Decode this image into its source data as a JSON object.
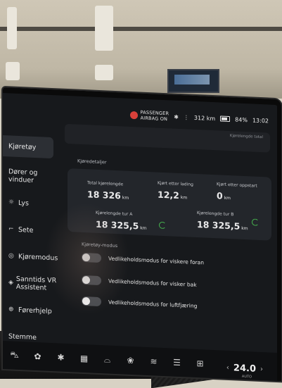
{
  "status_bar": {
    "airbag_line1": "PASSENGER",
    "airbag_line2": "AIRBAG ON",
    "range": "312 km",
    "battery": "84%",
    "time": "13:02"
  },
  "search": {
    "hint": "Kjørelengde total"
  },
  "sidebar": {
    "items": [
      {
        "label": "Kjøretøy",
        "icon": "car-icon"
      },
      {
        "label": "Dører og vinduer",
        "icon": "door-icon"
      },
      {
        "label": "Lys",
        "icon": "light-icon"
      },
      {
        "label": "Sete",
        "icon": "seat-icon"
      },
      {
        "label": "Kjøremodus",
        "icon": "steering-wheel-icon"
      },
      {
        "label": "Sanntids VR Assistent",
        "icon": "vr-assistant-icon"
      },
      {
        "label": "Førerhjelp",
        "icon": "driver-assist-icon"
      },
      {
        "label": "Stemme",
        "icon": "voice-icon"
      }
    ]
  },
  "details": {
    "title": "Kjøredetaljer",
    "total_label": "Total kjørelengde",
    "total_value": "18 326",
    "since_charge_label": "Kjørt etter lading",
    "since_charge_value": "12,2",
    "since_start_label": "Kjørt etter oppstart",
    "since_start_value": "0",
    "trip_a_label": "Kjørelengde tur A",
    "trip_a_value": "18 325,5",
    "trip_b_label": "Kjørelengde tur B",
    "trip_b_value": "18 325,5",
    "unit": "km"
  },
  "vehicle_mode": {
    "title": "Kjøretøy-modus",
    "toggles": [
      {
        "label": "Vedlikeholdsmodus for viskere foran"
      },
      {
        "label": "Vedlikeholdsmodus for visker bak"
      },
      {
        "label": "Vedlikeholdsmodus for luftfjæring"
      }
    ]
  },
  "climate": {
    "temperature": "24.0",
    "unit": "AUTO"
  },
  "colors": {
    "accent_green": "#47b54f",
    "airbag_red": "#d8403a"
  }
}
